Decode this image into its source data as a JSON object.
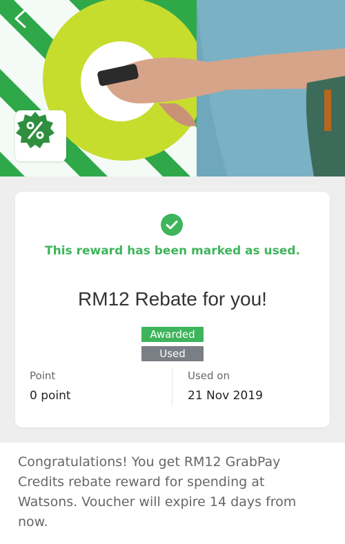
{
  "header": {
    "back_icon": "chevron-left-icon",
    "promo_icon": "percent-badge-icon"
  },
  "reward": {
    "status_icon": "check-circle-icon",
    "status_text": "This reward has been marked as used.",
    "title": "RM12 Rebate for you!",
    "badges": {
      "awarded": "Awarded",
      "used": "Used"
    },
    "point_label": "Point",
    "point_value": "0 point",
    "used_on_label": "Used on",
    "used_on_value": "21 Nov 2019"
  },
  "description": "Congratulations! You get RM12 GrabPay Credits rebate reward for spending at Watsons. Voucher will expire 14 days from now.",
  "colors": {
    "brand_green": "#3eb55a",
    "used_gray": "#7a7f86",
    "background_gray": "#eeeeee"
  }
}
